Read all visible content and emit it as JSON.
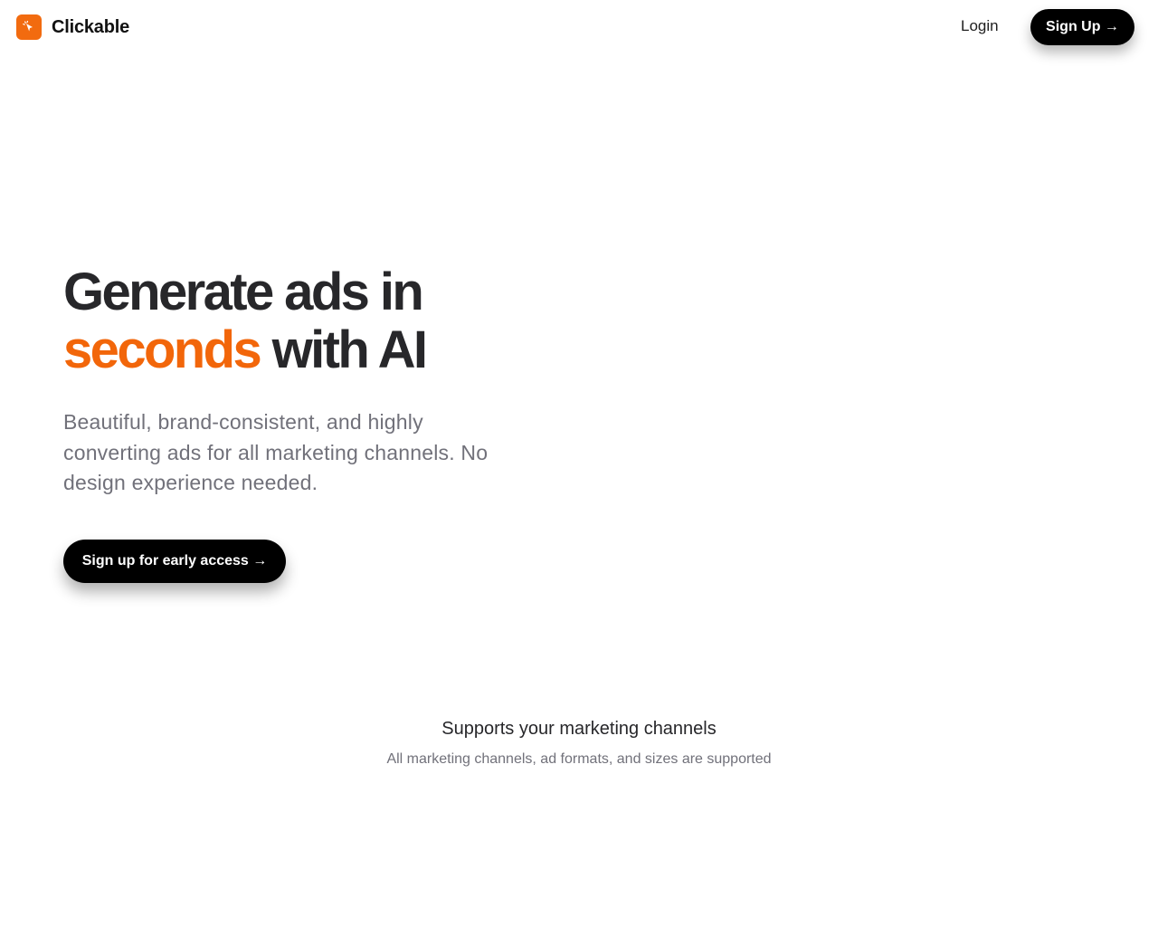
{
  "header": {
    "brand_name": "Clickable",
    "login_label": "Login",
    "signup_label": "Sign Up →"
  },
  "hero": {
    "title_line1": "Generate ads in",
    "title_accent": "seconds",
    "title_line2_rest": "with AI",
    "subtitle": "Beautiful, brand-consistent, and highly converting ads for all marketing channels. No design experience needed.",
    "cta_label": "Sign up for early access →"
  },
  "channels": {
    "title": "Supports your marketing channels",
    "subtitle": "All marketing channels, ad formats, and sizes are supported"
  },
  "icons": {
    "logo": "cursor-click-icon"
  },
  "colors": {
    "accent": "#f26b0f",
    "primary_button": "#000000",
    "heading": "#27272a",
    "muted_text": "#71717a"
  }
}
